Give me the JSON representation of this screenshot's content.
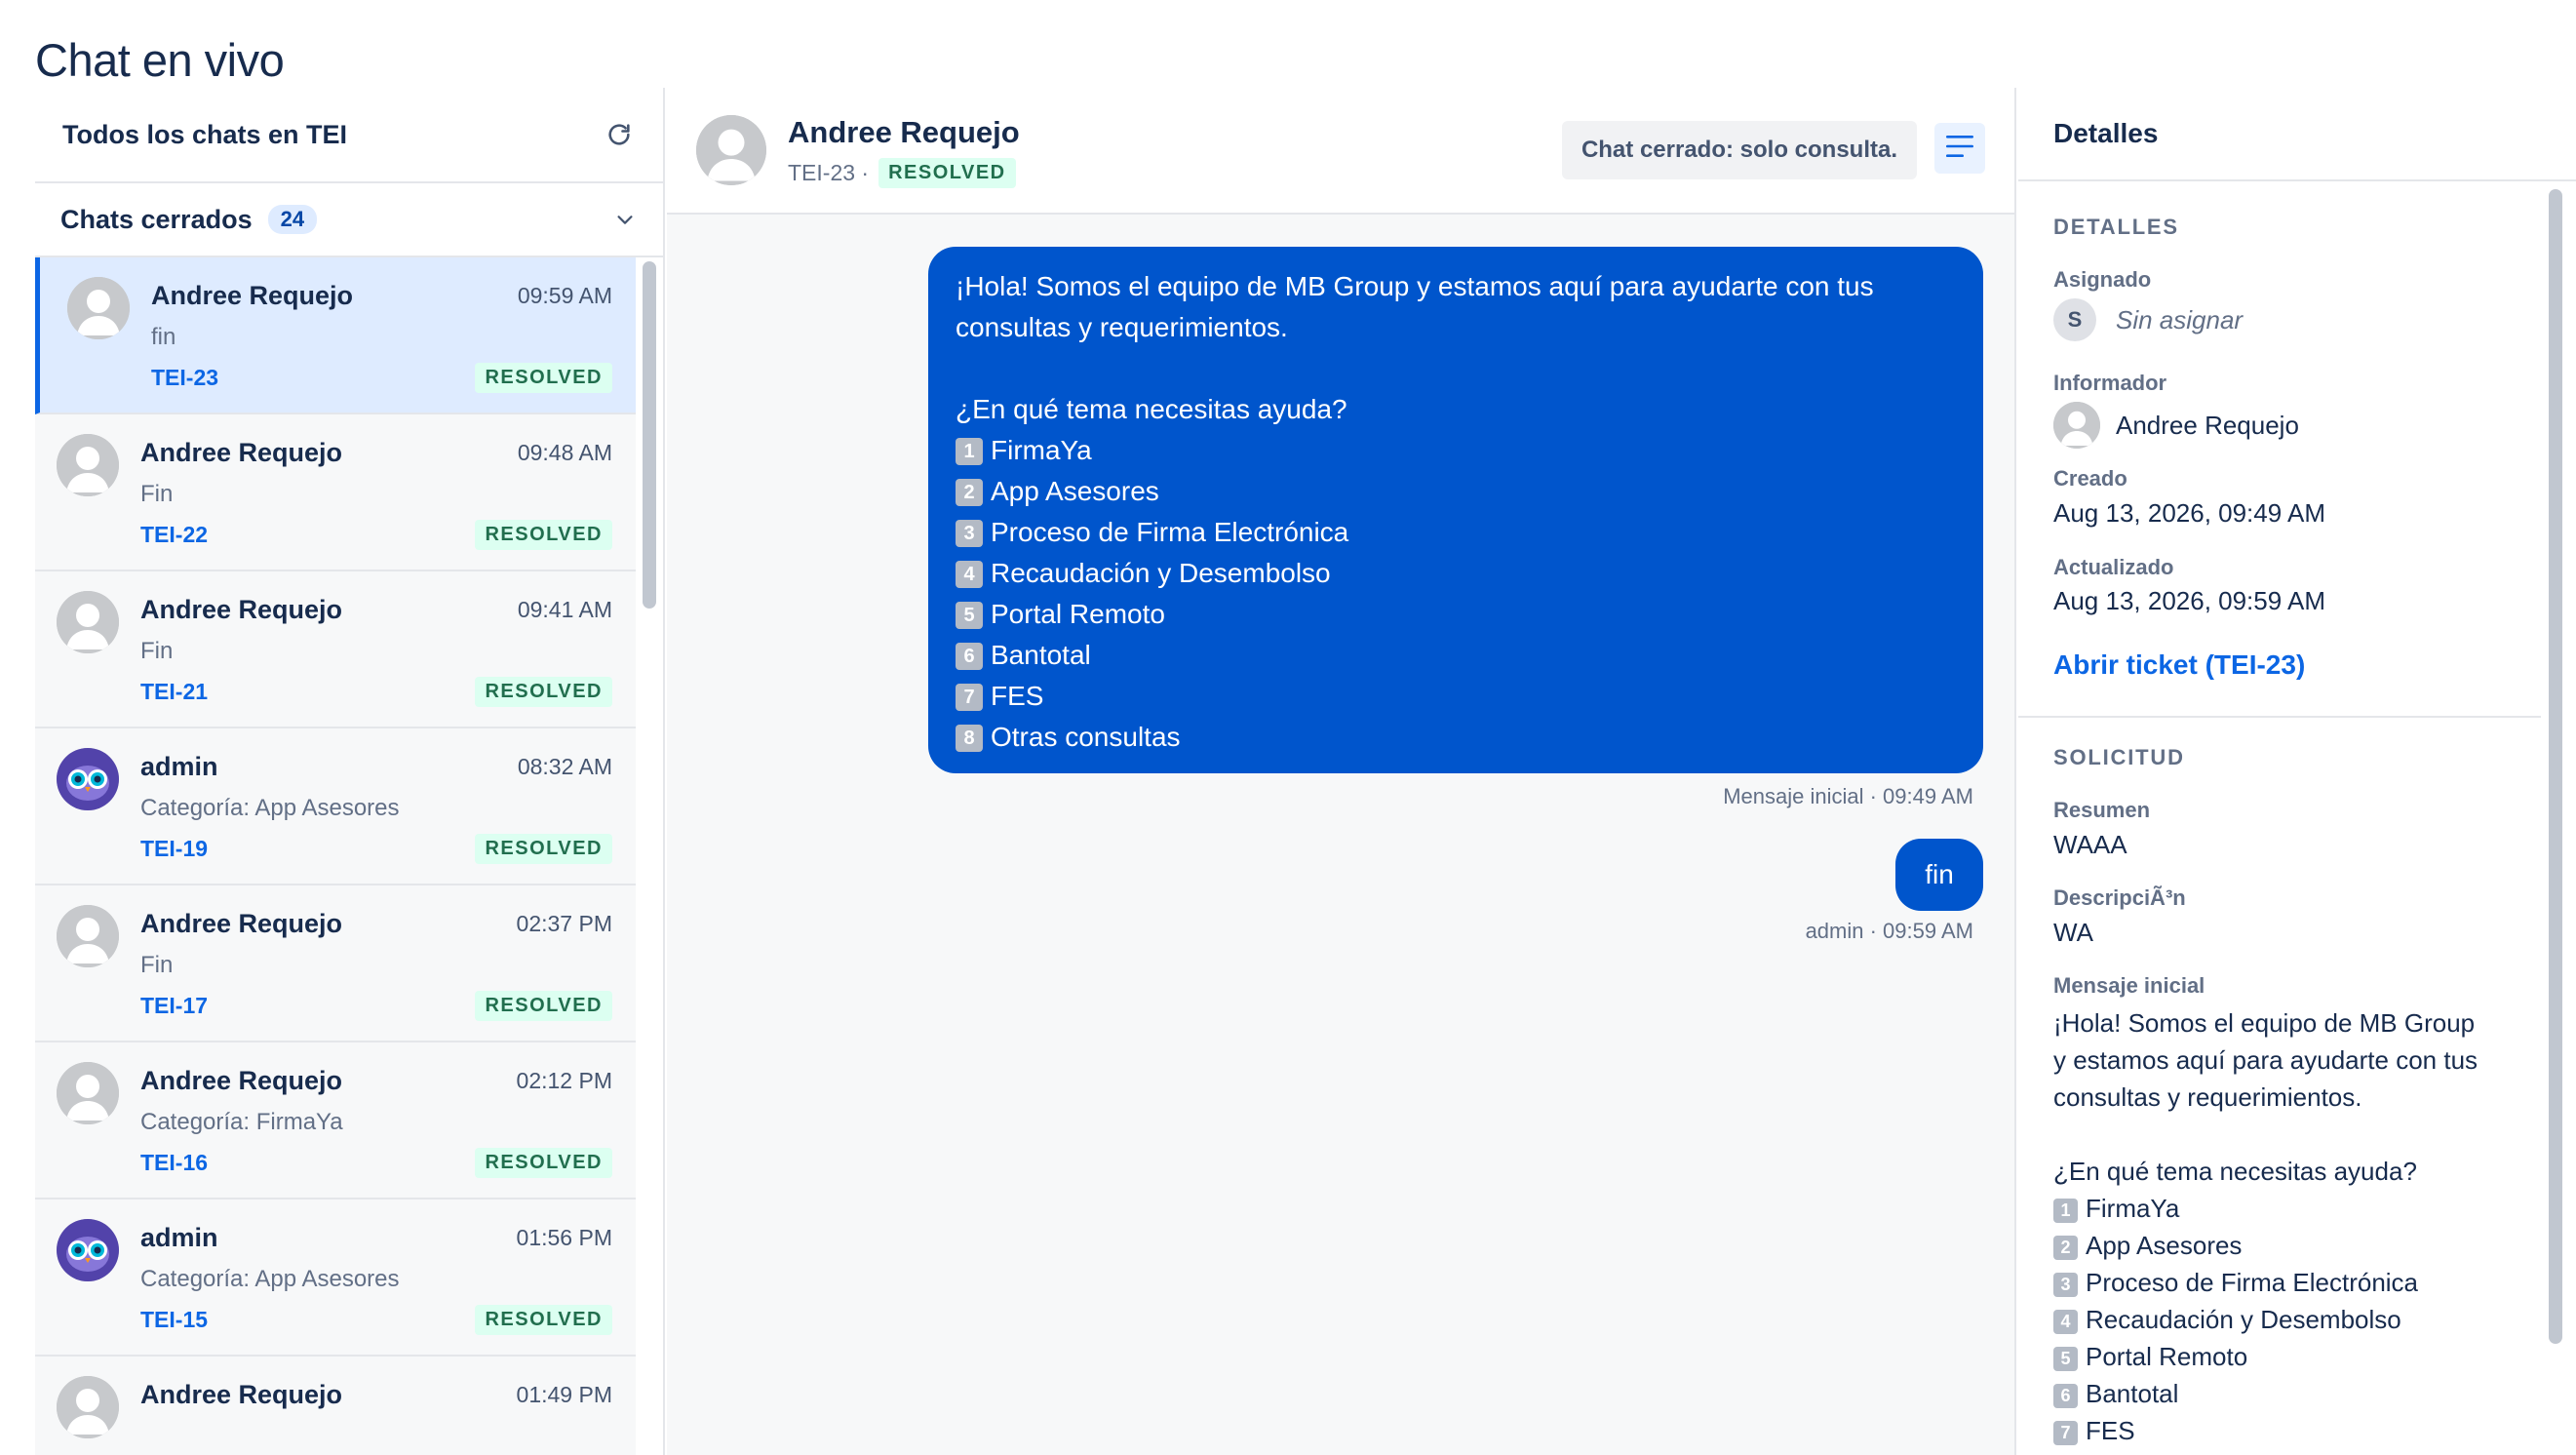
{
  "page": {
    "title": "Chat en vivo"
  },
  "sidebar": {
    "header": "Todos los chats en TEI",
    "group_label": "Chats cerrados",
    "group_count": "24",
    "chats": [
      {
        "name": "Andree Requejo",
        "time": "09:59 AM",
        "preview": "fin",
        "key": "TEI-23",
        "status": "RESOLVED",
        "avatar": "person"
      },
      {
        "name": "Andree Requejo",
        "time": "09:48 AM",
        "preview": "Fin",
        "key": "TEI-22",
        "status": "RESOLVED",
        "avatar": "person"
      },
      {
        "name": "Andree Requejo",
        "time": "09:41 AM",
        "preview": "Fin",
        "key": "TEI-21",
        "status": "RESOLVED",
        "avatar": "person"
      },
      {
        "name": "admin",
        "time": "08:32 AM",
        "preview": "Categoría: App Asesores",
        "key": "TEI-19",
        "status": "RESOLVED",
        "avatar": "owl"
      },
      {
        "name": "Andree Requejo",
        "time": "02:37 PM",
        "preview": "Fin",
        "key": "TEI-17",
        "status": "RESOLVED",
        "avatar": "person"
      },
      {
        "name": "Andree Requejo",
        "time": "02:12 PM",
        "preview": "Categoría: FirmaYa",
        "key": "TEI-16",
        "status": "RESOLVED",
        "avatar": "person"
      },
      {
        "name": "admin",
        "time": "01:56 PM",
        "preview": "Categoría: App Asesores",
        "key": "TEI-15",
        "status": "RESOLVED",
        "avatar": "owl"
      },
      {
        "name": "Andree Requejo",
        "time": "01:49 PM",
        "preview": "",
        "key": "",
        "status": "",
        "avatar": "person"
      }
    ]
  },
  "conversation": {
    "name": "Andree Requejo",
    "key": "TEI-23 ·",
    "status": "RESOLVED",
    "closed_note": "Chat cerrado: solo consulta.",
    "messages": [
      {
        "lines": [
          {
            "num": "",
            "text": "¡Hola! Somos el equipo de MB Group y estamos aquí para ayudarte con tus"
          },
          {
            "num": "",
            "text": "consultas y requerimientos."
          },
          {
            "num": "",
            "text": ""
          },
          {
            "num": "",
            "text": "¿En qué tema necesitas ayuda?"
          },
          {
            "num": "1",
            "text": "FirmaYa"
          },
          {
            "num": "2",
            "text": "App Asesores"
          },
          {
            "num": "3",
            "text": "Proceso de Firma Electrónica"
          },
          {
            "num": "4",
            "text": "Recaudación y Desembolso"
          },
          {
            "num": "5",
            "text": "Portal Remoto"
          },
          {
            "num": "6",
            "text": "Bantotal"
          },
          {
            "num": "7",
            "text": "FES"
          },
          {
            "num": "8",
            "text": "Otras consultas"
          }
        ],
        "meta": "Mensaje inicial · 09:49 AM"
      },
      {
        "text": "fin",
        "meta": "admin · 09:59 AM"
      }
    ]
  },
  "details": {
    "header": "Detalles",
    "section1_title": "DETALLES",
    "assigned_label": "Asignado",
    "assigned_initial": "S",
    "assigned_value": "Sin asignar",
    "reporter_label": "Informador",
    "reporter_value": "Andree Requejo",
    "created_label": "Creado",
    "created_value": "Aug 13, 2026, 09:49 AM",
    "updated_label": "Actualizado",
    "updated_value": "Aug 13, 2026, 09:59 AM",
    "open_ticket": "Abrir ticket (TEI-23)",
    "section2_title": "SOLICITUD",
    "summary_label": "Resumen",
    "summary_value": "WAAA",
    "description_label": "DescripciÃ³n",
    "description_value": "WA",
    "initial_message_label": "Mensaje inicial",
    "initial_message_lines": [
      {
        "num": "",
        "text": "¡Hola! Somos el equipo de MB Group"
      },
      {
        "num": "",
        "text": "y estamos aquí para ayudarte con tus"
      },
      {
        "num": "",
        "text": "consultas y requerimientos."
      },
      {
        "num": "",
        "text": ""
      },
      {
        "num": "",
        "text": "¿En qué tema necesitas ayuda?"
      },
      {
        "num": "1",
        "text": "FirmaYa"
      },
      {
        "num": "2",
        "text": "App Asesores"
      },
      {
        "num": "3",
        "text": "Proceso de Firma Electrónica"
      },
      {
        "num": "4",
        "text": "Recaudación y Desembolso"
      },
      {
        "num": "5",
        "text": "Portal Remoto"
      },
      {
        "num": "6",
        "text": "Bantotal"
      },
      {
        "num": "7",
        "text": "FES"
      }
    ]
  },
  "colors": {
    "accent": "#0c66e4",
    "bubble": "#0055cc",
    "resolved_bg": "#dcfff1",
    "resolved_text": "#216e4e",
    "active_row": "#deebff"
  },
  "icons": {
    "refresh": "refresh-icon",
    "chevron": "chevron-down-icon",
    "menu": "menu-lines-icon",
    "avatar": "user-avatar-icon",
    "owl": "owl-avatar-icon"
  }
}
